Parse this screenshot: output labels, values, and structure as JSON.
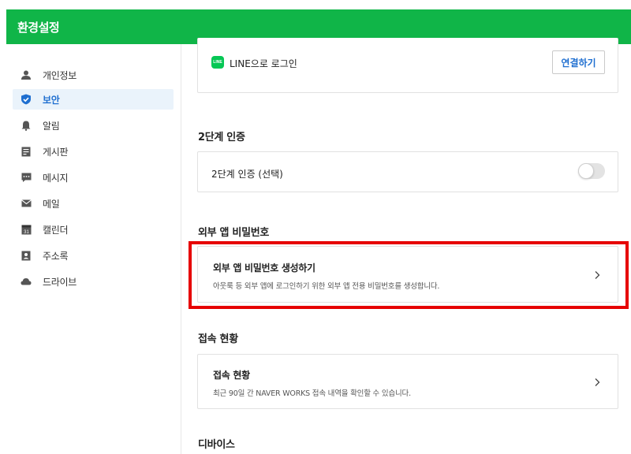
{
  "header": {
    "title": "환경설정"
  },
  "sidebar": {
    "items": [
      {
        "label": "개인정보",
        "icon": "person-icon"
      },
      {
        "label": "보안",
        "icon": "shield-check-icon",
        "active": true
      },
      {
        "label": "알림",
        "icon": "bell-icon"
      },
      {
        "label": "게시판",
        "icon": "board-icon"
      },
      {
        "label": "메시지",
        "icon": "message-icon"
      },
      {
        "label": "메일",
        "icon": "mail-icon"
      },
      {
        "label": "캘린더",
        "icon": "calendar-icon",
        "calendar_day": "31"
      },
      {
        "label": "주소록",
        "icon": "address-book-icon"
      },
      {
        "label": "드라이브",
        "icon": "cloud-icon"
      }
    ]
  },
  "line_login": {
    "logo_text": "LINE",
    "label": "LINE으로 로그인",
    "button_label": "연결하기"
  },
  "two_factor": {
    "section_title": "2단계 인증",
    "label": "2단계 인증 (선택)",
    "enabled": false
  },
  "app_password": {
    "section_title": "외부 앱 비밀번호",
    "card_title": "외부 앱 비밀번호 생성하기",
    "card_desc": "아웃룩 등 외부 앱에 로그인하기 위한 외부 앱 전용 비밀번호를 생성합니다."
  },
  "access_status": {
    "section_title": "접속 현황",
    "card_title": "접속 현황",
    "card_desc": "최근 90일 간 NAVER WORKS 접속 내역을 확인할 수 있습니다."
  },
  "devices": {
    "section_title": "디바이스"
  },
  "colors": {
    "header_bg": "#10b548",
    "active_nav_text": "#1f6fd0",
    "highlight_border": "#e60000"
  }
}
